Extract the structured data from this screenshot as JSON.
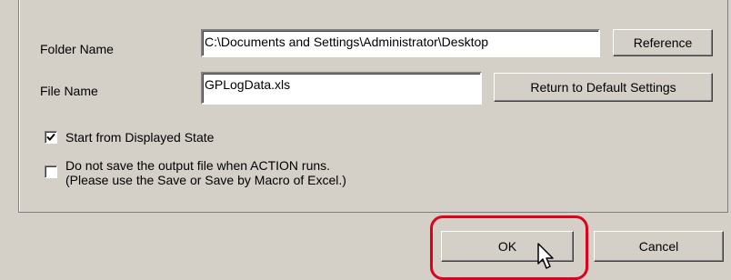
{
  "folder": {
    "label": "Folder Name",
    "value": "C:\\Documents and Settings\\Administrator\\Desktop",
    "reference_button": "Reference"
  },
  "file": {
    "label": "File Name",
    "value": "GPLogData.xls",
    "default_button": "Return to Default Settings"
  },
  "options": [
    {
      "label": "Start from Displayed State",
      "checked": true
    },
    {
      "label_line1": "Do not save the output file when ACTION runs.",
      "label_line2": "(Please use the Save or Save by Macro of Excel.)",
      "checked": false
    }
  ],
  "buttons": {
    "ok": "OK",
    "cancel": "Cancel"
  },
  "colors": {
    "dialog_bg": "#d4d0c8",
    "highlight": "#e0001b"
  },
  "icons": [
    "checkmark-icon",
    "mouse-pointer-icon"
  ]
}
